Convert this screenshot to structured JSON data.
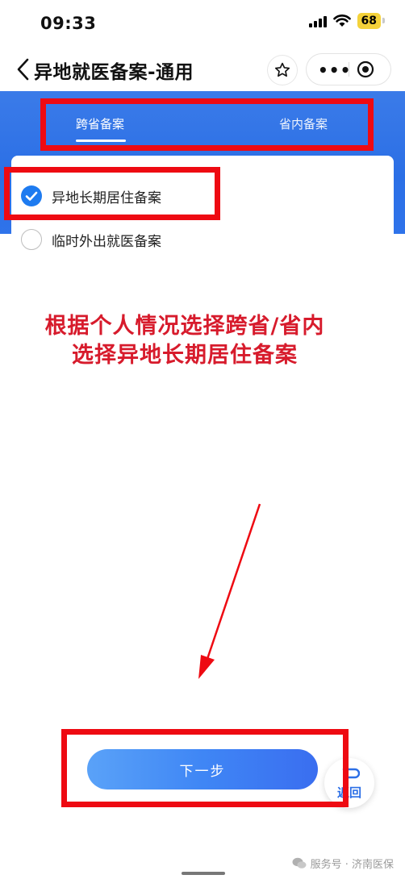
{
  "status_bar": {
    "time": "09:33",
    "battery": "68"
  },
  "nav": {
    "title": "异地就医备案-通用"
  },
  "tabs": [
    {
      "label": "跨省备案",
      "selected": true
    },
    {
      "label": "省内备案",
      "selected": false
    }
  ],
  "options": [
    {
      "label": "异地长期居住备案",
      "checked": true
    },
    {
      "label": "临时外出就医备案",
      "checked": false
    }
  ],
  "annotation": {
    "line1": "根据个人情况选择跨省/省内",
    "line2": "选择异地长期居住备案"
  },
  "actions": {
    "next_label": "下一步",
    "return_label": "返回"
  },
  "footer": {
    "text": "服务号 · 济南医保"
  },
  "colors": {
    "primary": "#2b6fe6",
    "annotation_red": "#d71b2c",
    "highlight_box": "#ee0a12"
  }
}
